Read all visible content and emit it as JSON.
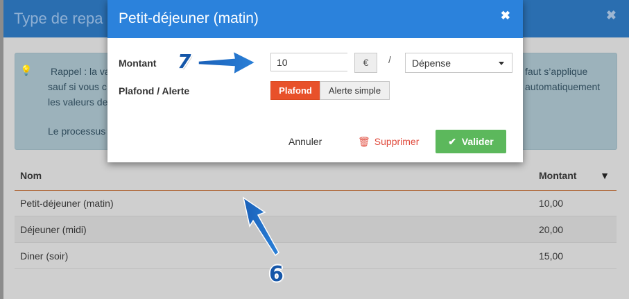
{
  "background": {
    "title": "Type de repa",
    "close_icon": "close-icon",
    "alert": {
      "icon": "lightbulb-icon",
      "line1": "Rappel : la va",
      "line2": "sauf si vous c",
      "line3": "les valeurs de",
      "line4": "Le processus",
      "right1": "faut s’applique",
      "right2": "automatiquement"
    },
    "table": {
      "columns": {
        "name": "Nom",
        "amount": "Montant"
      },
      "filter_icon": "filter-icon",
      "rows": [
        {
          "name": "Petit-déjeuner (matin)",
          "amount": "10,00"
        },
        {
          "name": "Déjeuner (midi)",
          "amount": "20,00"
        },
        {
          "name": "Diner (soir)",
          "amount": "15,00"
        }
      ]
    }
  },
  "dialog": {
    "title": "Petit-déjeuner (matin)",
    "close_icon": "close-icon",
    "amount_label": "Montant",
    "amount_value": "10",
    "currency": "€",
    "separator": "/",
    "type_select": {
      "selected": "Dépense"
    },
    "threshold_label": "Plafond / Alerte",
    "toggle": {
      "active": "Plafond",
      "inactive": "Alerte simple"
    },
    "buttons": {
      "cancel": "Annuler",
      "delete": "Supprimer",
      "validate": "Valider"
    },
    "colors": {
      "header": "#2b82dc",
      "active_toggle": "#e8512a",
      "validate": "#5cb85c",
      "delete": "#e04a3c"
    }
  },
  "annotations": {
    "step_a": "7",
    "step_b": "6"
  }
}
